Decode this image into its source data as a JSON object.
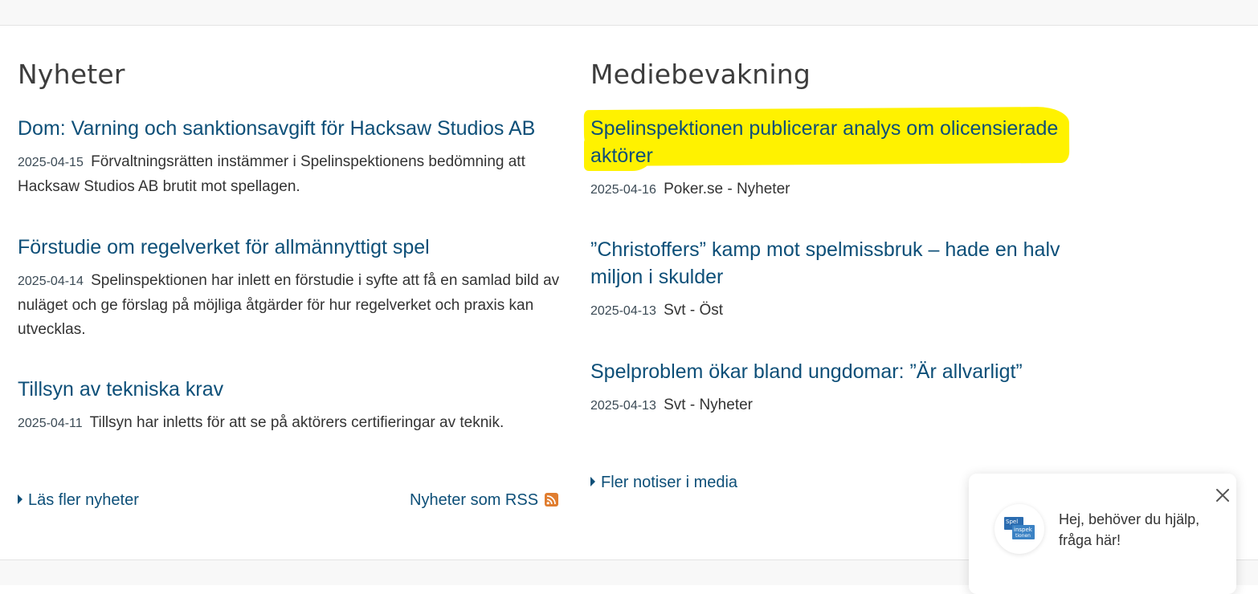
{
  "news": {
    "title": "Nyheter",
    "items": [
      {
        "title": "Dom: Varning och sanktionsavgift för Hacksaw Studios AB",
        "date": "2025-04-15",
        "summary": "Förvaltningsrätten instämmer i Spelinspektionens bedömning att Hacksaw Studios AB brutit mot spellagen."
      },
      {
        "title": "Förstudie om regelverket för allmännyttigt spel",
        "date": "2025-04-14",
        "summary": "Spelinspektionen har inlett en förstudie i syfte att få en samlad bild av nuläget och ge förslag på möjliga åtgärder för hur regelverket och praxis kan utvecklas."
      },
      {
        "title": "Tillsyn av tekniska krav",
        "date": "2025-04-11",
        "summary": "Tillsyn har inletts för att se på aktörers certifieringar av teknik."
      }
    ],
    "more_link": "Läs fler nyheter",
    "rss_link": "Nyheter som RSS"
  },
  "media": {
    "title": "Mediebevakning",
    "highlight_color": "#fff200",
    "items": [
      {
        "title": "Spelinspektionen publicerar analys om olicensierade aktörer",
        "date": "2025-04-16",
        "source": "Poker.se - Nyheter",
        "highlighted": true
      },
      {
        "title": "”Christoffers” kamp mot spelmissbruk – hade en halv miljon i skulder",
        "date": "2025-04-13",
        "source": "Svt - Öst"
      },
      {
        "title": "Spelproblem ökar bland ungdomar: ”Är allvarligt”",
        "date": "2025-04-13",
        "source": "Svt - Nyheter"
      }
    ],
    "more_link": "Fler notiser i media"
  },
  "chat": {
    "message": "Hej, behöver du hjälp, fråga här!",
    "avatar_logo_text": "Spel inspek tionen",
    "close_icon": "close-icon"
  },
  "colors": {
    "link": "#0d4f78",
    "heading": "#3d3d3d",
    "rss": "#e07d2f"
  }
}
